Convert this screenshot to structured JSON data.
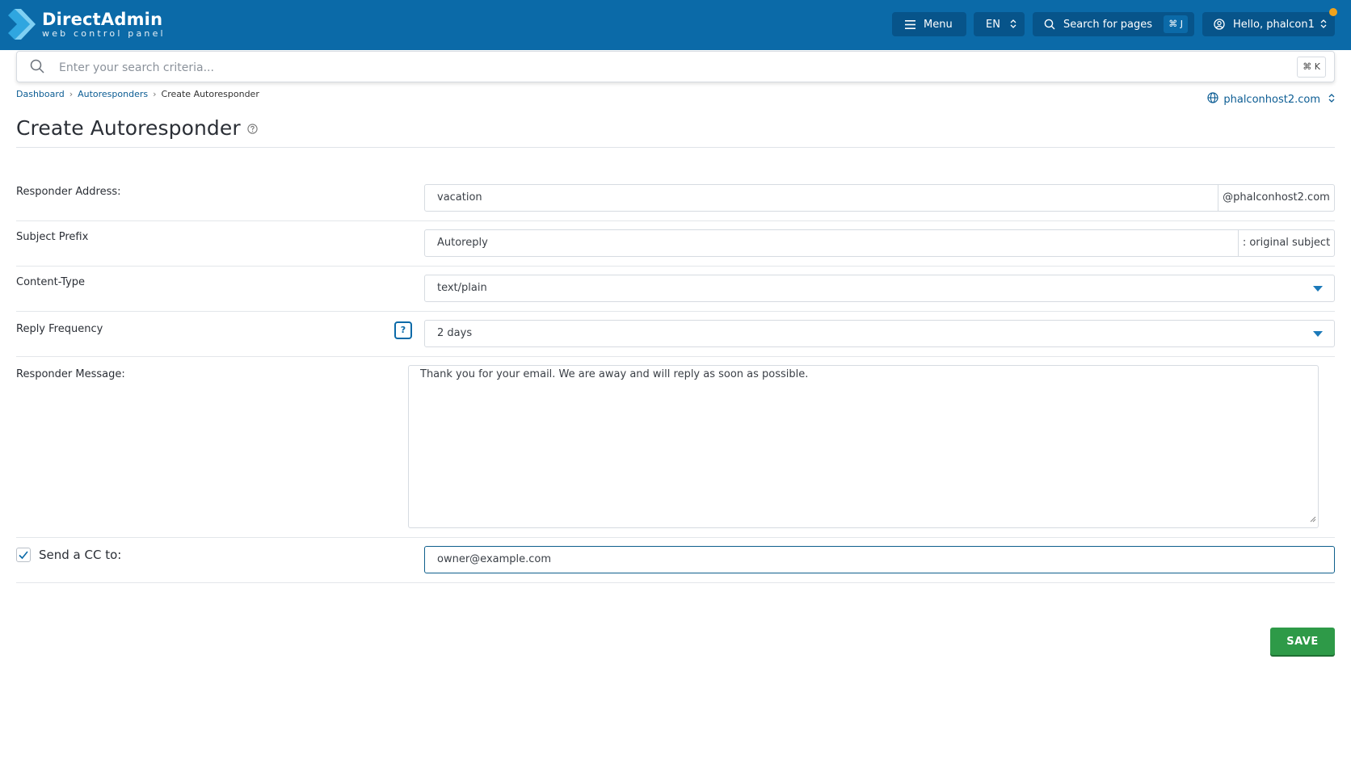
{
  "app": {
    "logo_title": "DirectAdmin",
    "logo_subtitle": "web control panel",
    "brand_color": "#0b6aa8"
  },
  "header": {
    "menu_label": "Menu",
    "language": "EN",
    "search_pages_label": "Search for pages",
    "search_pages_shortcut": "⌘ J",
    "user_greeting": "Hello, phalcon1"
  },
  "search": {
    "placeholder": "Enter your search criteria...",
    "shortcut": "⌘ K"
  },
  "breadcrumb": {
    "items": [
      "Dashboard",
      "Autoresponders",
      "Create Autoresponder"
    ]
  },
  "domain_selector": {
    "value": "phalconhost2.com"
  },
  "page": {
    "title": "Create Autoresponder"
  },
  "form": {
    "responder_address": {
      "label": "Responder Address:",
      "value": "vacation",
      "suffix": "@phalconhost2.com"
    },
    "subject_prefix": {
      "label": "Subject Prefix",
      "value": "Autoreply",
      "suffix": ": original subject"
    },
    "content_type": {
      "label": "Content-Type",
      "value": "text/plain"
    },
    "reply_frequency": {
      "label": "Reply Frequency",
      "value": "2 days",
      "help": "?"
    },
    "responder_message": {
      "label": "Responder Message:",
      "value": "Thank you for your email. We are away and will reply as soon as possible."
    },
    "send_cc": {
      "label": "Send a CC to:",
      "checked": true,
      "value": "owner@example.com"
    },
    "save_label": "SAVE"
  }
}
